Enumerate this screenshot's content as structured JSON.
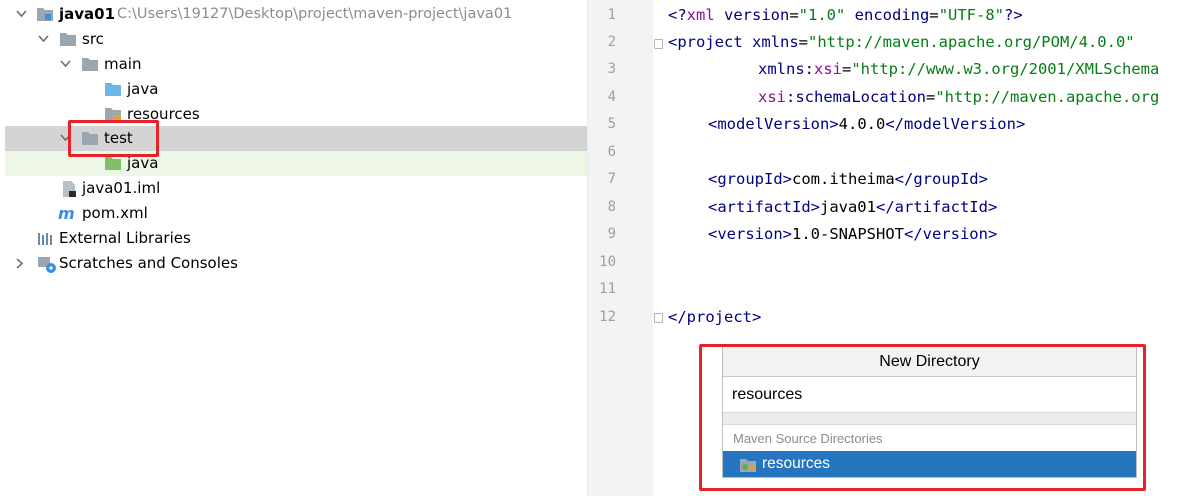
{
  "tree": {
    "project": {
      "name": "java01",
      "path": "C:\\Users\\19127\\Desktop\\project\\maven-project\\java01"
    },
    "src": "src",
    "main": "main",
    "main_java": "java",
    "main_resources": "resources",
    "test": "test",
    "test_java": "java",
    "iml": "java01.iml",
    "pom": "pom.xml",
    "external_libraries": "External Libraries",
    "scratches": "Scratches and Consoles"
  },
  "editor": {
    "line_numbers": [
      "1",
      "2",
      "3",
      "4",
      "5",
      "6",
      "7",
      "8",
      "9",
      "10",
      "11",
      "12"
    ],
    "lines": {
      "l1_a": "<?",
      "l1_b": "xml",
      "l1_c": " version",
      "l1_d": "=",
      "l1_e": "\"1.0\"",
      "l1_f": " encoding",
      "l1_g": "=",
      "l1_h": "\"UTF-8\"",
      "l1_i": "?>",
      "l2_a": "<project ",
      "l2_b": "xmlns",
      "l2_c": "=",
      "l2_d": "\"http://maven.apache.org/POM/4.0.0\"",
      "l3_a": "xmlns:",
      "l3_b": "xsi",
      "l3_c": "=",
      "l3_d": "\"http://www.w3.org/2001/XMLSchema",
      "l4_a": "xsi",
      "l4_b": ":schemaLocation",
      "l4_c": "=",
      "l4_d": "\"http://maven.apache.org",
      "l5_a": "<modelVersion>",
      "l5_b": "4.0.0",
      "l5_c": "</modelVersion>",
      "l7_a": "<groupId>",
      "l7_b": "com.itheima",
      "l7_c": "</groupId>",
      "l8_a": "<artifactId>",
      "l8_b": "java01",
      "l8_c": "</artifactId>",
      "l9_a": "<version>",
      "l9_b": "1.0-SNAPSHOT",
      "l9_c": "</version>",
      "l12_a": "</project>"
    }
  },
  "popup": {
    "title": "New Directory",
    "input_value": "resources",
    "section": "Maven Source Directories",
    "item": "resources"
  },
  "colors": {
    "selection": "#d4d4d4",
    "highlight_row": "#eef6e6",
    "annotation_red": "#e8202a",
    "popup_selected": "#2675bf",
    "xml_tag": "#000080",
    "xml_value": "#067d17"
  }
}
